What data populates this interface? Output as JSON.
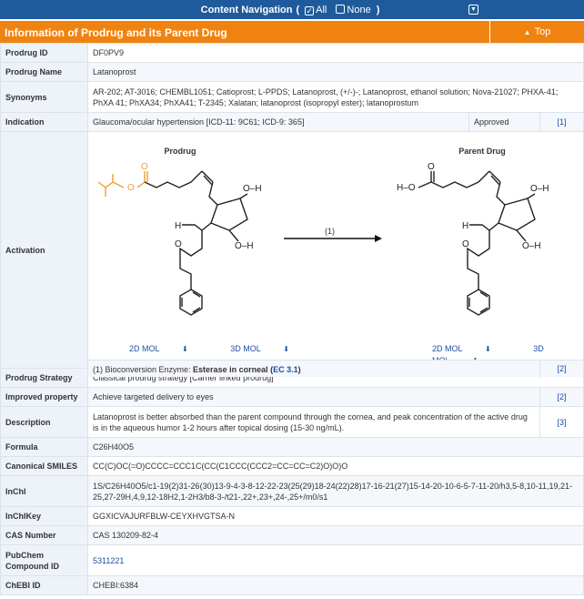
{
  "nav": {
    "title": "Content Navigation",
    "open_paren": "(",
    "all_label": "All",
    "none_label": "None",
    "close_paren": ")"
  },
  "section": {
    "title": "Information of Prodrug and its Parent Drug",
    "top_label": "Top"
  },
  "rows": {
    "prodrug_id": {
      "label": "Prodrug ID",
      "value": "DF0PV9"
    },
    "prodrug_name": {
      "label": "Prodrug Name",
      "value": "Latanoprost"
    },
    "synonyms": {
      "label": "Synonyms",
      "value": "AR-202; AT-3016; CHEMBL1051; Catioprost; L-PPDS; Latanoprost, (+/-)-; Latanoprost, ethanol solution; Nova-21027; PHXA-41; PhXA 41; PhXA34; PhXA41; T-2345; Xalatan; latanoprost (isopropyl ester); latanoprostum"
    },
    "indication": {
      "label": "Indication",
      "value": "Glaucoma/ocular hypertension [ICD-11: 9C61; ICD-9: 365]",
      "status": "Approved",
      "ref": "[1]"
    },
    "activation": {
      "label": "Activation",
      "prodrug_title": "Prodrug",
      "parent_title": "Parent Drug",
      "arrow_label": "(1)",
      "mol2d": "2D MOL",
      "mol3d": "3D MOL",
      "enzyme_prefix": "(1) Bioconversion Enzyme: ",
      "enzyme_name": "Esterase in corneal",
      "enzyme_ec_open": " (",
      "enzyme_ec": "EC 3.1",
      "enzyme_ec_close": ")",
      "enzyme_ref": "[2]"
    },
    "strategy": {
      "label": "Prodrug Strategy",
      "value": "Classical prodrug strategy [Carrier linked prodrug]"
    },
    "improved": {
      "label": "Improved property",
      "value": "Achieve targeted delivery to eyes",
      "ref": "[2]"
    },
    "description": {
      "label": "Description",
      "value": "Latanoprost is better absorbed than the parent compound through the cornea, and peak concentration of the active drug is in the aqueous humor 1-2 hours after topical dosing (15-30 ng/mL).",
      "ref": "[3]"
    },
    "formula": {
      "label": "Formula",
      "value": "C26H40O5"
    },
    "smiles": {
      "label": "Canonical SMILES",
      "value": "CC(C)OC(=O)CCCC=CCC1C(CC(C1CCC(CCC2=CC=CC=C2)O)O)O"
    },
    "inchi": {
      "label": "InChI",
      "value": "1S/C26H40O5/c1-19(2)31-26(30)13-9-4-3-8-12-22-23(25(29)18-24(22)28)17-16-21(27)15-14-20-10-6-5-7-11-20/h3,5-8,10-11,19,21-25,27-29H,4,9,12-18H2,1-2H3/b8-3-/t21-,22+,23+,24-,25+/m0/s1"
    },
    "inchikey": {
      "label": "InChIKey",
      "value": "GGXICVAJURFBLW-CEYXHVGTSA-N"
    },
    "cas": {
      "label": "CAS Number",
      "value": "CAS 130209-82-4"
    },
    "pubchem": {
      "label": "PubChem Compound ID",
      "value": "5311221"
    },
    "chebi": {
      "label": "ChEBI ID",
      "value": "CHEBI:6384"
    }
  },
  "atoms": {
    "O": "O",
    "H": "H",
    "OH": "OH"
  },
  "colors": {
    "nav_bg": "#1f5b9c",
    "header_bg": "#f0830f",
    "ester_highlight": "#f0a030",
    "link": "#1d4fa3"
  },
  "icons": [
    "check-square-icon",
    "square-icon",
    "chevron-down-icon",
    "caret-up-icon",
    "download-icon"
  ]
}
